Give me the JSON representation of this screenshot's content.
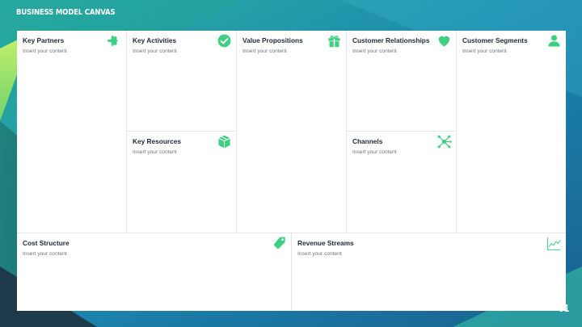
{
  "slide": {
    "title": "BUSINESS MODEL CANVAS",
    "page_number": "01"
  },
  "colors": {
    "accent": "#3ecf82",
    "background": "#1d6f9a",
    "text": "#1f2a36",
    "subtext": "#6b7280"
  },
  "blocks": {
    "key_partners": {
      "title": "Key Partners",
      "subtitle": "Insert your content",
      "icon": "puzzle-icon"
    },
    "key_activities": {
      "title": "Key Activities",
      "subtitle": "Insert your content",
      "icon": "check-circle-icon"
    },
    "key_resources": {
      "title": "Key Resources",
      "subtitle": "Insert your content",
      "icon": "box-icon"
    },
    "value_propositions": {
      "title": "Value Propositions",
      "subtitle": "Insert your content",
      "icon": "gift-icon"
    },
    "customer_relationships": {
      "title": "Customer Relationships",
      "subtitle": "Insert your content",
      "icon": "heart-icon"
    },
    "channels": {
      "title": "Channels",
      "subtitle": "Insert your content",
      "icon": "network-icon"
    },
    "customer_segments": {
      "title": "Customer Segments",
      "subtitle": "Insert your content",
      "icon": "user-icon"
    },
    "cost_structure": {
      "title": "Cost Structure",
      "subtitle": "Insert your content",
      "icon": "price-tag-icon"
    },
    "revenue_streams": {
      "title": "Revenue Streams",
      "subtitle": "Insert your content",
      "icon": "line-chart-icon"
    }
  }
}
